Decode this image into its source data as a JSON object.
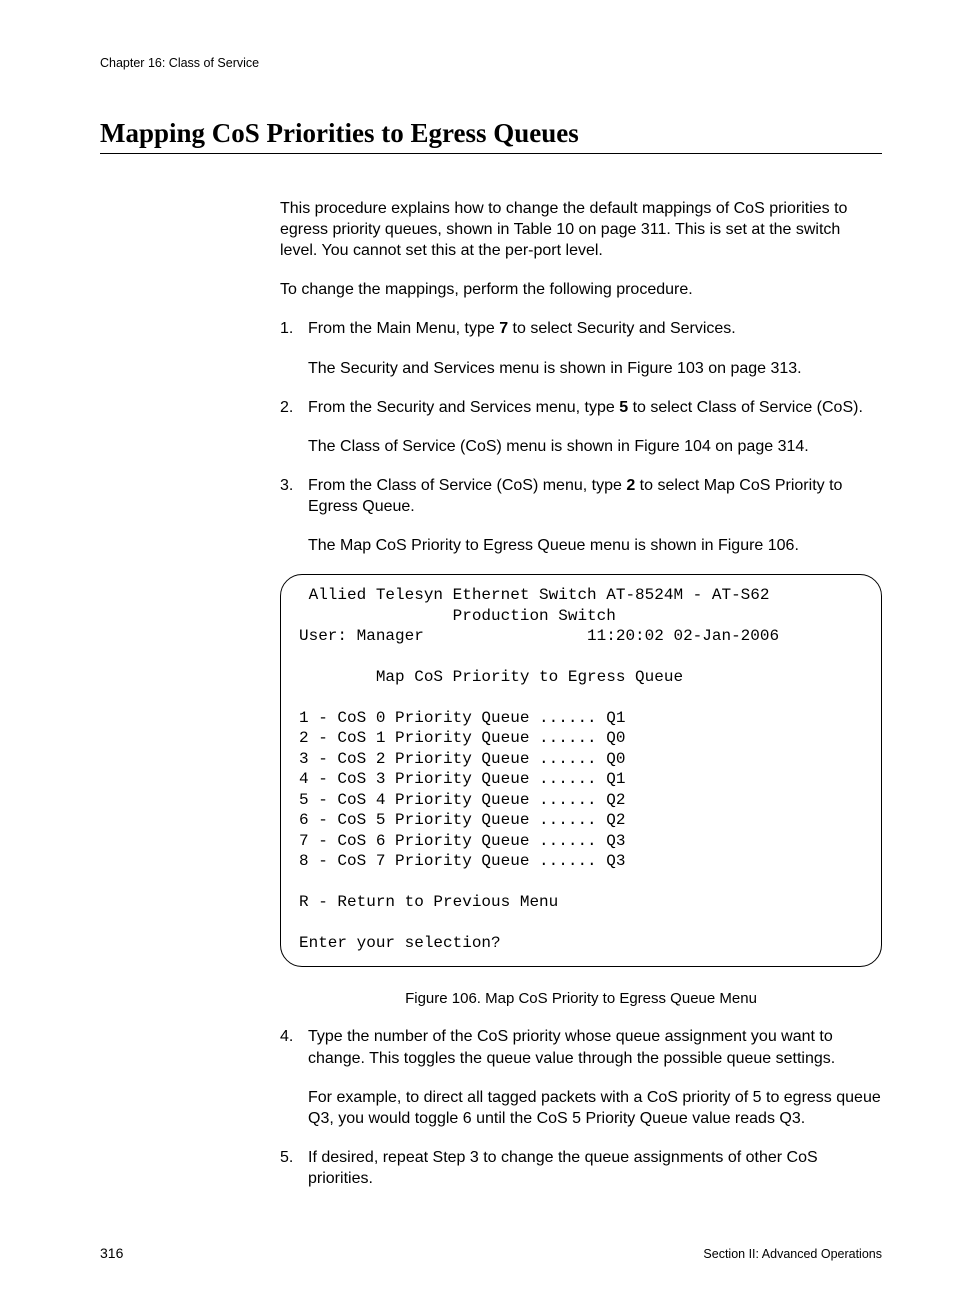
{
  "header": {
    "chapter": "Chapter 16: Class of Service"
  },
  "title": "Mapping CoS Priorities to Egress Queues",
  "intro": {
    "p1": "This procedure explains how to change the default mappings of CoS priorities to egress priority queues, shown in Table 10 on page 311. This is set at the switch level. You cannot set this at the per-port level.",
    "p2": "To change the mappings, perform the following procedure."
  },
  "steps": {
    "s1": {
      "num": "1.",
      "text_a": "From the Main Menu, type ",
      "bold": "7",
      "text_b": " to select Security and Services.",
      "after": "The Security and Services menu is shown in Figure 103 on page 313."
    },
    "s2": {
      "num": "2.",
      "text_a": "From the Security and Services menu, type ",
      "bold": "5",
      "text_b": " to select Class of Service (CoS).",
      "after": "The Class of Service (CoS) menu is shown in Figure 104 on page 314."
    },
    "s3": {
      "num": "3.",
      "text_a": "From the Class of Service (CoS) menu, type ",
      "bold": "2",
      "text_b": " to select Map CoS Priority to Egress Queue.",
      "after": "The Map CoS Priority to Egress Queue menu is shown in Figure 106."
    },
    "s4": {
      "num": "4.",
      "text": "Type the number of the CoS priority whose queue assignment you want to change. This toggles the queue value through the possible queue settings.",
      "after": "For example, to direct all tagged packets with a CoS priority of 5 to egress queue Q3, you would toggle 6 until the CoS 5 Priority Queue value reads Q3."
    },
    "s5": {
      "num": "5.",
      "text": "If desired, repeat Step 3 to change the queue assignments of other CoS priorities."
    }
  },
  "terminal": {
    "line1": " Allied Telesyn Ethernet Switch AT-8524M - AT-S62",
    "line2": "                Production Switch",
    "line3": "User: Manager                 11:20:02 02-Jan-2006",
    "blank1": " ",
    "line4": "        Map CoS Priority to Egress Queue",
    "blank2": " ",
    "m1": "1 - CoS 0 Priority Queue ...... Q1",
    "m2": "2 - CoS 1 Priority Queue ...... Q0",
    "m3": "3 - CoS 2 Priority Queue ...... Q0",
    "m4": "4 - CoS 3 Priority Queue ...... Q1",
    "m5": "5 - CoS 4 Priority Queue ...... Q2",
    "m6": "6 - CoS 5 Priority Queue ...... Q2",
    "m7": "7 - CoS 6 Priority Queue ...... Q3",
    "m8": "8 - CoS 7 Priority Queue ...... Q3",
    "blank3": " ",
    "r": "R - Return to Previous Menu",
    "blank4": " ",
    "prompt": "Enter your selection?"
  },
  "figure_caption": "Figure 106. Map CoS Priority to Egress Queue Menu",
  "footer": {
    "page": "316",
    "section": "Section II: Advanced Operations"
  }
}
